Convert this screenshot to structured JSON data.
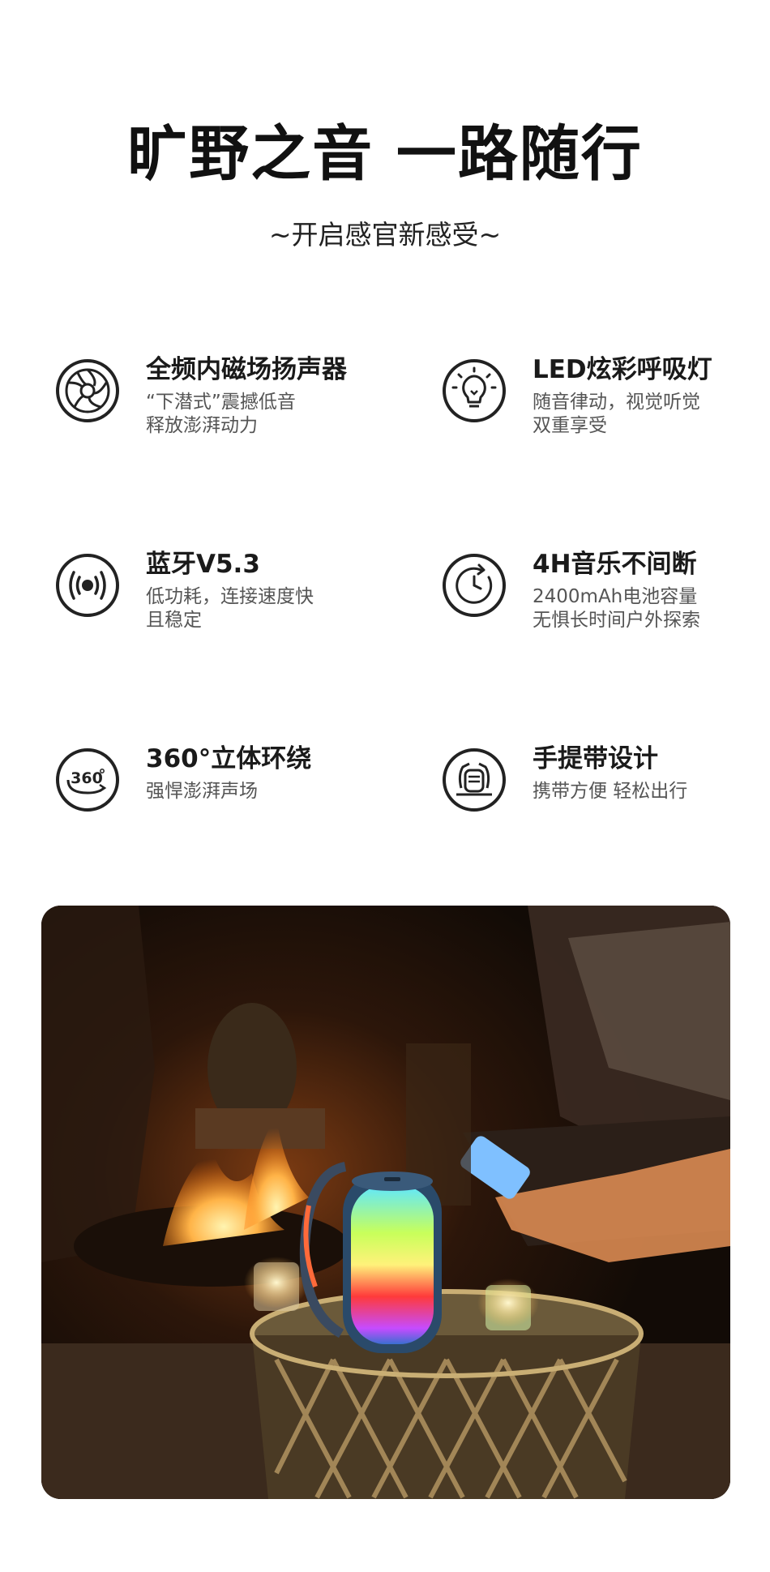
{
  "header": {
    "title": "旷野之音 一路随行",
    "subtitle": "~开启感官新感受~"
  },
  "features": [
    {
      "icon": "speaker-driver-icon",
      "title": "全频内磁场扬声器",
      "lines": [
        "“下潜式”震撼低音",
        "释放澎湃动力"
      ]
    },
    {
      "icon": "light-bulb-icon",
      "title": "LED炫彩呼吸灯",
      "lines": [
        "随音律动，视觉听觉",
        "双重享受"
      ]
    },
    {
      "icon": "bluetooth-signal-icon",
      "title": "蓝牙V5.3",
      "lines": [
        "低功耗，连接速度快",
        "且稳定"
      ]
    },
    {
      "icon": "timer-icon",
      "title": "4H音乐不间断",
      "lines": [
        "2400mAh电池容量",
        "无惧长时间户外探索"
      ]
    },
    {
      "icon": "surround-360-icon",
      "title": "360°立体环绕",
      "lines": [
        "强悍澎湃声场"
      ]
    },
    {
      "icon": "handle-strap-icon",
      "title": "手提带设计",
      "lines": [
        "携带方便 轻松出行"
      ]
    }
  ],
  "photo": {
    "icon": "product-lifestyle-photo",
    "colors": {
      "night": "#140d08",
      "fire": "#ff8a1e",
      "speaker_cyan": "#5fe7ff",
      "speaker_green": "#c8ff5a",
      "speaker_red": "#ff3a3a"
    }
  }
}
